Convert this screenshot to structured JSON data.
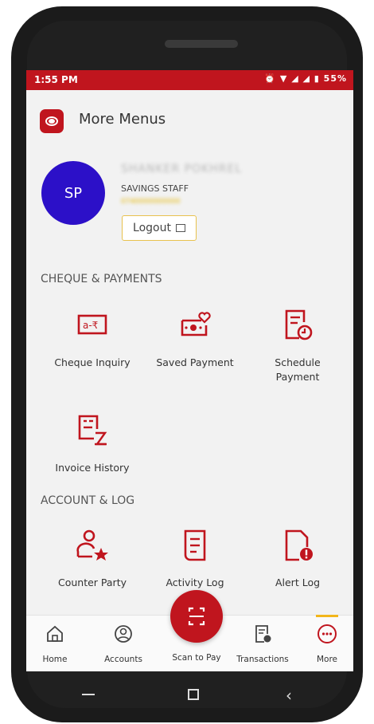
{
  "status_bar": {
    "time": "1:55 PM",
    "icons": "⏰ ▼ ◢ ◢ ▮ 55%"
  },
  "header": {
    "title": "More Menus"
  },
  "profile": {
    "initials": "SP",
    "name": "SHANKER POKHREL",
    "role": "SAVINGS STAFF",
    "account": "0740000000000",
    "logout_label": "Logout"
  },
  "sections": {
    "cheque_payments": {
      "title": "CHEQUE & PAYMENTS",
      "items": [
        {
          "label": "Cheque Inquiry",
          "icon": "cheque-icon"
        },
        {
          "label": "Saved Payment",
          "icon": "saved-payment-icon"
        },
        {
          "label": "Schedule\nPayment",
          "icon": "schedule-payment-icon"
        },
        {
          "label": "Invoice History",
          "icon": "invoice-history-icon"
        }
      ]
    },
    "account_log": {
      "title": "ACCOUNT & LOG",
      "items": [
        {
          "label": "Counter Party",
          "icon": "counter-party-icon"
        },
        {
          "label": "Activity Log",
          "icon": "activity-log-icon"
        },
        {
          "label": "Alert Log",
          "icon": "alert-log-icon"
        }
      ]
    }
  },
  "bottom_nav": {
    "home": "Home",
    "accounts": "Accounts",
    "scan": "Scan to Pay",
    "transactions": "Transactions",
    "more": "More"
  },
  "colors": {
    "brand": "#c0151e",
    "avatar": "#2c10c8",
    "accent": "#f2b61b"
  }
}
